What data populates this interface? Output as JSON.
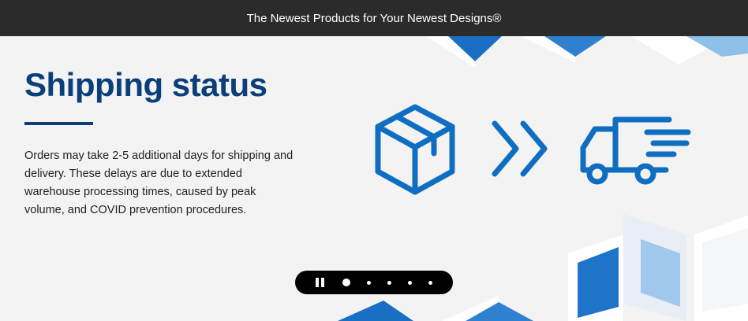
{
  "top_bar": {
    "message": "The Newest Products for Your Newest Designs®"
  },
  "banner": {
    "title": "Shipping status",
    "description": "Orders may take 2-5 additional days for shipping and delivery. These delays are due to extended warehouse processing times, caused by peak volume, and COVID prevention procedures.",
    "icons": [
      "package-box-icon",
      "double-chevron-right-icon",
      "delivery-truck-icon"
    ],
    "accent_color": "#0b3f7a",
    "icon_color": "#0f6ec1"
  },
  "carousel": {
    "slide_count": 5,
    "active_slide": 1,
    "paused": false
  }
}
